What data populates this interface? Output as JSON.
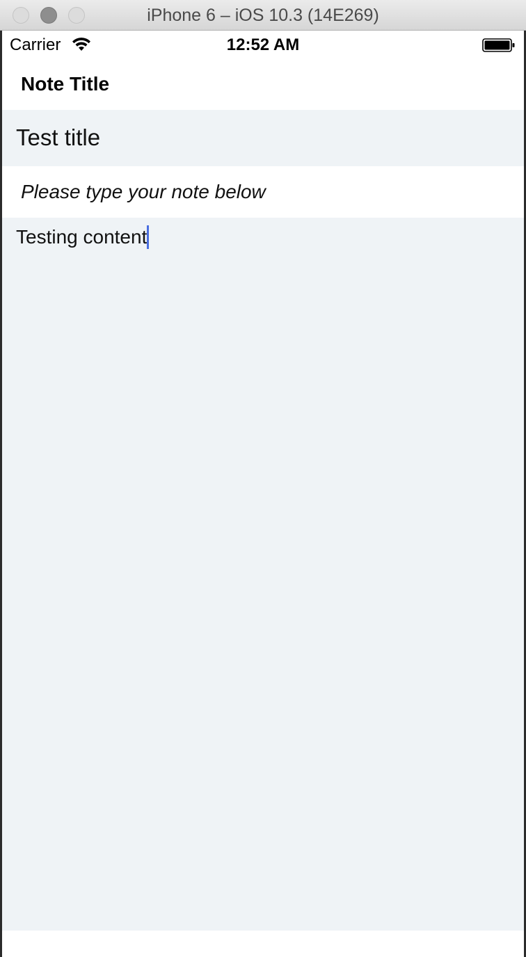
{
  "window": {
    "title": "iPhone 6 – iOS 10.3 (14E269)"
  },
  "statusbar": {
    "carrier": "Carrier",
    "time": "12:52 AM",
    "wifi_icon": "wifi-icon",
    "battery_icon": "battery-icon"
  },
  "nav": {
    "title": "Note Title"
  },
  "note": {
    "title_value": "Test title",
    "hint": "Please type your note below",
    "content_value": "Testing content"
  },
  "colors": {
    "field_background": "#eff3f6",
    "cursor": "#4a6ee0",
    "window_chrome": "#d6d6d6"
  }
}
